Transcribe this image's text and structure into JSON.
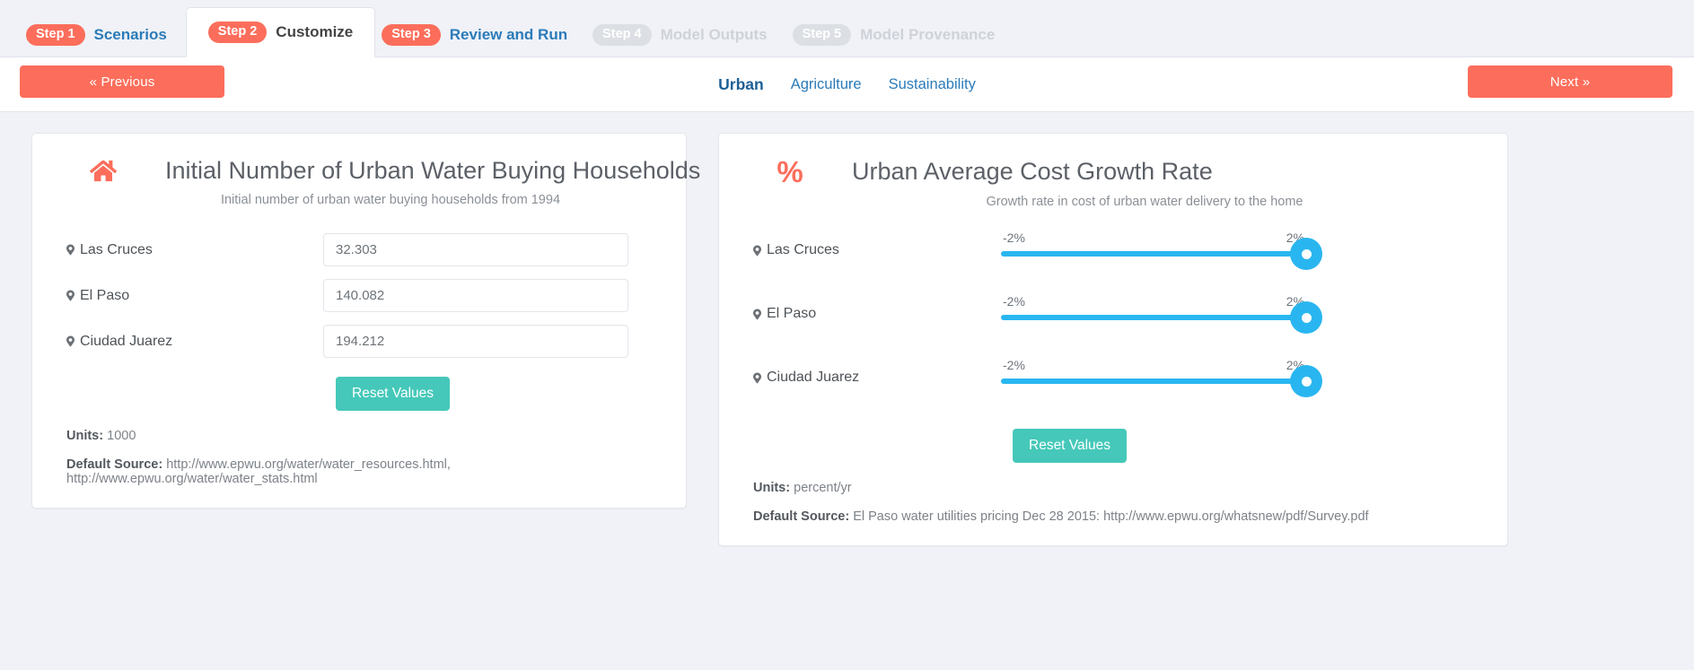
{
  "steps": [
    {
      "badge": "Step 1",
      "label": "Scenarios",
      "state": "enabled"
    },
    {
      "badge": "Step 2",
      "label": "Customize",
      "state": "active"
    },
    {
      "badge": "Step 3",
      "label": "Review and Run",
      "state": "enabled"
    },
    {
      "badge": "Step 4",
      "label": "Model Outputs",
      "state": "disabled"
    },
    {
      "badge": "Step 5",
      "label": "Model Provenance",
      "state": "disabled"
    }
  ],
  "nav": {
    "previous_label": "« Previous",
    "next_label": "Next »",
    "categories": [
      {
        "label": "Urban",
        "active": true
      },
      {
        "label": "Agriculture",
        "active": false
      },
      {
        "label": "Sustainability",
        "active": false
      }
    ]
  },
  "cards": [
    {
      "icon": "home-icon",
      "title": "Initial Number of Urban Water Buying Households",
      "subtitle": "Initial number of urban water buying households from 1994",
      "control_type": "number-input",
      "rows": [
        {
          "location": "Las Cruces",
          "value": "32.303"
        },
        {
          "location": "El Paso",
          "value": "140.082"
        },
        {
          "location": "Ciudad Juarez",
          "value": "194.212"
        }
      ],
      "reset_label": "Reset Values",
      "units_label": "Units:",
      "units_value": "1000",
      "source_label": "Default Source:",
      "source_value": "http://www.epwu.org/water/water_resources.html, http://www.epwu.org/water/water_stats.html"
    },
    {
      "icon": "percent-icon",
      "title": "Urban Average Cost Growth Rate",
      "subtitle": "Growth rate in cost of urban water delivery to the home",
      "control_type": "slider",
      "rows": [
        {
          "location": "Las Cruces",
          "min_label": "-2%",
          "max_label": "2%",
          "value": "2%",
          "percent": 100
        },
        {
          "location": "El Paso",
          "min_label": "-2%",
          "max_label": "2%",
          "value": "2%",
          "percent": 100
        },
        {
          "location": "Ciudad Juarez",
          "min_label": "-2%",
          "max_label": "2%",
          "value": "2%",
          "percent": 100
        }
      ],
      "reset_label": "Reset Values",
      "units_label": "Units:",
      "units_value": "percent/yr",
      "source_label": "Default Source:",
      "source_value": "El Paso water utilities pricing Dec 28 2015: http://www.epwu.org/whatsnew/pdf/Survey.pdf"
    }
  ],
  "colors": {
    "accent_coral": "#fc6e5b",
    "accent_teal": "#45c8b9",
    "accent_blue": "#29b6f0",
    "link_blue": "#2b7bb9",
    "page_bg": "#f0f2f7"
  }
}
